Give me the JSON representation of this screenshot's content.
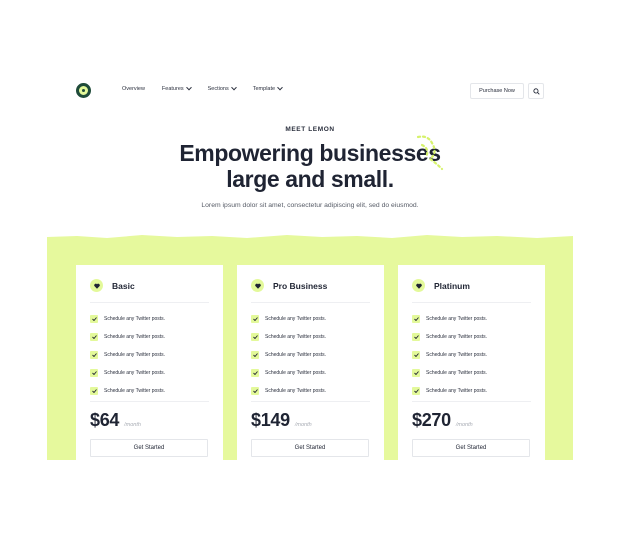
{
  "nav": {
    "items": [
      {
        "label": "Overview",
        "dropdown": false
      },
      {
        "label": "Features",
        "dropdown": true
      },
      {
        "label": "Sections",
        "dropdown": true
      },
      {
        "label": "Template",
        "dropdown": true
      }
    ],
    "purchase_label": "Purchase Now",
    "search_icon": "search-icon",
    "logo_icon": "lemon-logo-icon"
  },
  "hero": {
    "eyebrow": "MEET LEMON",
    "headline_line1": "Empowering businesses",
    "headline_line2": "large and small.",
    "subtext": "Lorem ipsum dolor sit amet, consectetur adipiscing elit, sed do eiusmod."
  },
  "colors": {
    "accent": "#e3f99a",
    "band": "#e6f99d",
    "dark": "#1f2433"
  },
  "plans": [
    {
      "name": "Basic",
      "icon": "heart-icon",
      "features": [
        "Schedule any Twitter posts.",
        "Schedule any Twitter posts.",
        "Schedule any Twitter posts.",
        "Schedule any Twitter posts.",
        "Schedule any Twitter posts."
      ],
      "price": "$64",
      "period": "/month",
      "cta": "Get Started"
    },
    {
      "name": "Pro Business",
      "icon": "heart-icon",
      "features": [
        "Schedule any Twitter posts.",
        "Schedule any Twitter posts.",
        "Schedule any Twitter posts.",
        "Schedule any Twitter posts.",
        "Schedule any Twitter posts."
      ],
      "price": "$149",
      "period": "/month",
      "cta": "Get Started"
    },
    {
      "name": "Platinum",
      "icon": "heart-icon",
      "features": [
        "Schedule any Twitter posts.",
        "Schedule any Twitter posts.",
        "Schedule any Twitter posts.",
        "Schedule any Twitter posts.",
        "Schedule any Twitter posts."
      ],
      "price": "$270",
      "period": "/month",
      "cta": "Get Started"
    }
  ]
}
